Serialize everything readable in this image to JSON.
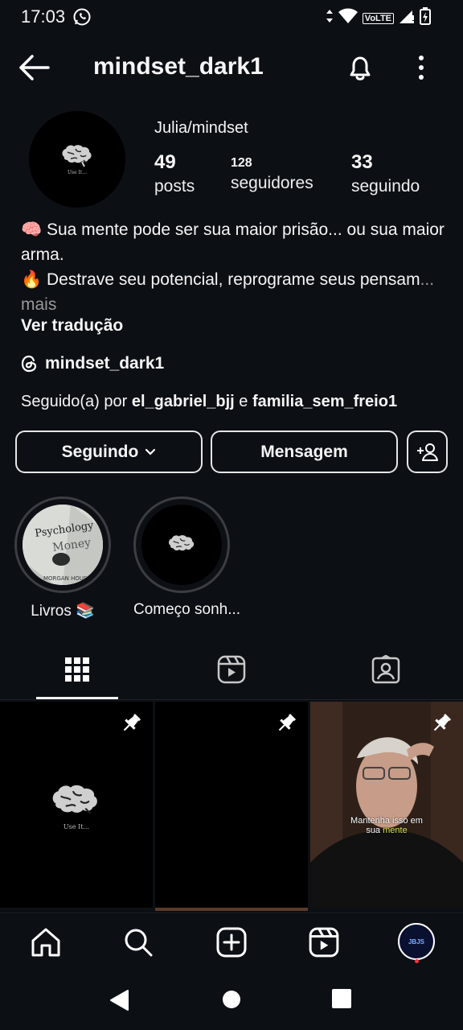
{
  "status_bar": {
    "time": "17:03",
    "network": "VoLTE"
  },
  "header": {
    "username": "mindset_dark1"
  },
  "profile": {
    "avatar_caption": "Use It...",
    "display_name": "Julia/mindset",
    "stats": [
      {
        "value": "49",
        "label": "posts"
      },
      {
        "value": "128",
        "label": "seguidores"
      },
      {
        "value": "33",
        "label": "seguindo"
      }
    ],
    "bio_line1": "🧠 Sua mente pode ser sua maior prisão... ou sua maior arma.",
    "bio_line2": "🔥 Destrave seu potencial, reprograme seus pensam",
    "bio_more": "... mais",
    "translate": "Ver tradução",
    "threads_handle": "mindset_dark1",
    "followed_prefix": "Seguido(a) por ",
    "followed_user1": "el_gabriel_bjj",
    "followed_and": " e ",
    "followed_user2": "familia_sem_freio1"
  },
  "actions": {
    "following": "Seguindo",
    "message": "Mensagem"
  },
  "highlights": [
    {
      "label": "Livros 📚",
      "cover_text1": "Psychology",
      "cover_text2": "Money",
      "cover_text3": "MORGAN HOUSEL"
    },
    {
      "label": "Começo sonh..."
    }
  ],
  "posts": [
    {
      "caption": "Use It..."
    },
    {
      "caption": ""
    },
    {
      "caption_line1": "Mantenha isso em",
      "caption_line2_a": "sua ",
      "caption_line2_b": "mente"
    }
  ],
  "bottom_nav": {
    "profile_badge": "JBJS"
  },
  "colors": {
    "background": "#0c0f14",
    "text": "#f5f5f5",
    "muted": "#9a9a9a",
    "caption_highlight": "#d4e157",
    "notification": "#ff3040"
  }
}
